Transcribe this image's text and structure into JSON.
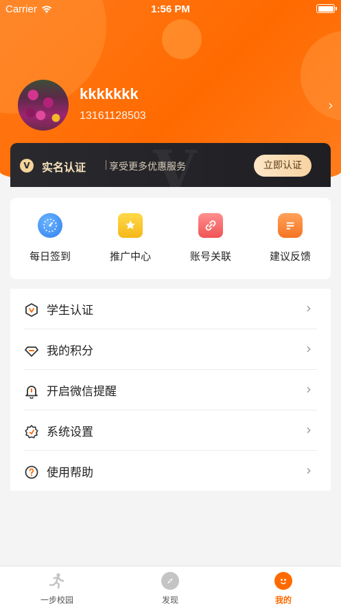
{
  "status_bar": {
    "carrier": "Carrier",
    "time": "1:56 PM"
  },
  "profile": {
    "username": "kkkkkkk",
    "phone": "13161128503"
  },
  "cert_banner": {
    "badge": "V",
    "watermark": "V",
    "title": "实名认证",
    "description": "享受更多优惠服务",
    "button": "立即认证"
  },
  "quick_actions": [
    {
      "label": "每日签到",
      "icon": "checkin-icon"
    },
    {
      "label": "推广中心",
      "icon": "promotion-star-icon"
    },
    {
      "label": "账号关联",
      "icon": "link-icon"
    },
    {
      "label": "建议反馈",
      "icon": "feedback-icon"
    }
  ],
  "menu": [
    {
      "label": "学生认证",
      "icon": "shield-v-icon"
    },
    {
      "label": "我的积分",
      "icon": "diamond-icon"
    },
    {
      "label": "开启微信提醒",
      "icon": "bell-icon"
    },
    {
      "label": "系统设置",
      "icon": "gear-icon"
    },
    {
      "label": "使用帮助",
      "icon": "help-icon"
    }
  ],
  "tabbar": [
    {
      "label": "一步校园",
      "icon": "runner-icon",
      "active": false
    },
    {
      "label": "发现",
      "icon": "compass-icon",
      "active": false
    },
    {
      "label": "我的",
      "icon": "face-icon",
      "active": true
    }
  ],
  "colors": {
    "accent": "#ff6a00",
    "banner_bg": "#2a2a2e",
    "banner_text": "#f7e2bd"
  }
}
